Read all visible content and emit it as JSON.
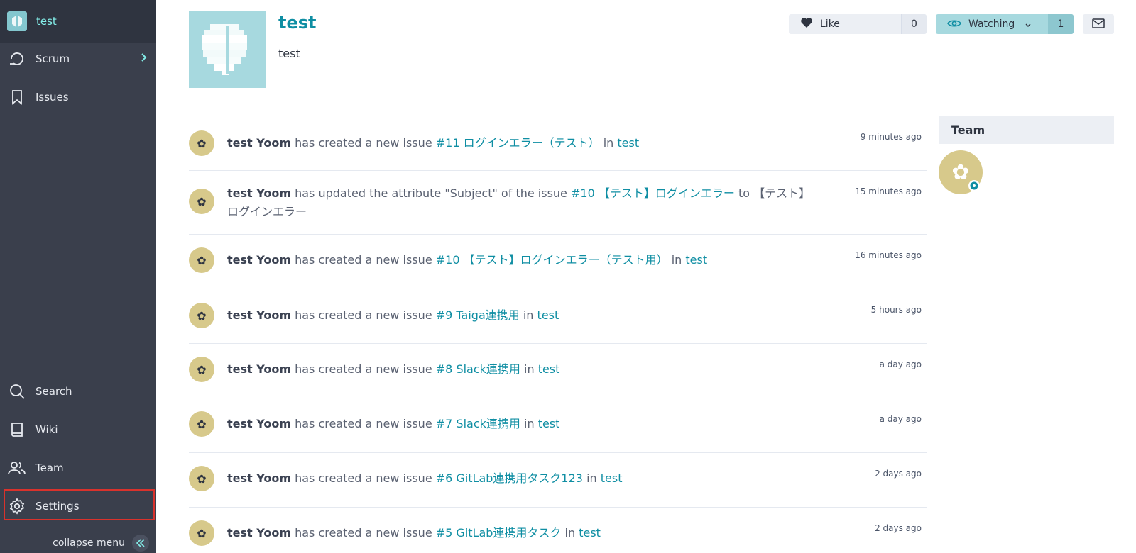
{
  "sidebar": {
    "project_name": "test",
    "items_top": [
      {
        "label": "Scrum",
        "icon": "scrum-cycle-icon"
      },
      {
        "label": "Issues",
        "icon": "bookmark-icon"
      }
    ],
    "items_bottom": [
      {
        "label": "Search",
        "icon": "search-icon"
      },
      {
        "label": "Wiki",
        "icon": "book-icon"
      },
      {
        "label": "Team",
        "icon": "team-icon"
      },
      {
        "label": "Settings",
        "icon": "gear-icon"
      }
    ],
    "collapse_label": "collapse menu"
  },
  "project": {
    "title": "test",
    "description": "test"
  },
  "actions": {
    "like_label": "Like",
    "like_count": "0",
    "watch_label": "Watching",
    "watch_count": "1"
  },
  "timeline": [
    {
      "user": "test Yoom",
      "action": "has created a new issue",
      "issue": "#11 ログインエラー（テスト）",
      "mid": "in",
      "target": "test",
      "time": "9 minutes ago"
    },
    {
      "user": "test Yoom",
      "action": "has updated the attribute \"Subject\" of the issue",
      "issue": "#10 【テスト】ログインエラー",
      "mid": "to",
      "target": "【テスト】ログインエラー",
      "time": "15 minutes ago"
    },
    {
      "user": "test Yoom",
      "action": "has created a new issue",
      "issue": "#10 【テスト】ログインエラー（テスト用）",
      "mid": "in",
      "target": "test",
      "time": "16 minutes ago"
    },
    {
      "user": "test Yoom",
      "action": "has created a new issue",
      "issue": "#9 Taiga連携用",
      "mid": "in",
      "target": "test",
      "time": "5 hours ago"
    },
    {
      "user": "test Yoom",
      "action": "has created a new issue",
      "issue": "#8 Slack連携用",
      "mid": "in",
      "target": "test",
      "time": "a day ago"
    },
    {
      "user": "test Yoom",
      "action": "has created a new issue",
      "issue": "#7 Slack連携用",
      "mid": "in",
      "target": "test",
      "time": "a day ago"
    },
    {
      "user": "test Yoom",
      "action": "has created a new issue",
      "issue": "#6 GitLab連携用タスク123",
      "mid": "in",
      "target": "test",
      "time": "2 days ago"
    },
    {
      "user": "test Yoom",
      "action": "has created a new issue",
      "issue": "#5 GitLab連携用タスク",
      "mid": "in",
      "target": "test",
      "time": "2 days ago"
    }
  ],
  "team": {
    "header": "Team"
  },
  "colors": {
    "sidebar_bg": "#3a3f4c",
    "accent": "#0f8ea3",
    "highlight": "#d9322c"
  }
}
